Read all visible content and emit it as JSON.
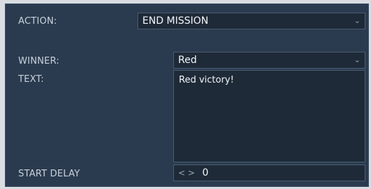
{
  "action": {
    "label": "ACTION:",
    "value": "END MISSION"
  },
  "winner": {
    "label": "WINNER:",
    "value": "Red"
  },
  "text": {
    "label": "TEXT:",
    "value": "Red victory!"
  },
  "start_delay": {
    "label": "START DELAY",
    "arrows": "< >",
    "value": "0"
  },
  "icons": {
    "dropdown": "chevron-down-icon",
    "stepper": "left-right-arrows-icon"
  },
  "colors": {
    "panel_bg": "#2b3b4f",
    "field_bg": "#1f2a38",
    "field_border": "#4a5c70",
    "label_text": "#c9d2dc",
    "value_text": "#f2f5f8"
  }
}
